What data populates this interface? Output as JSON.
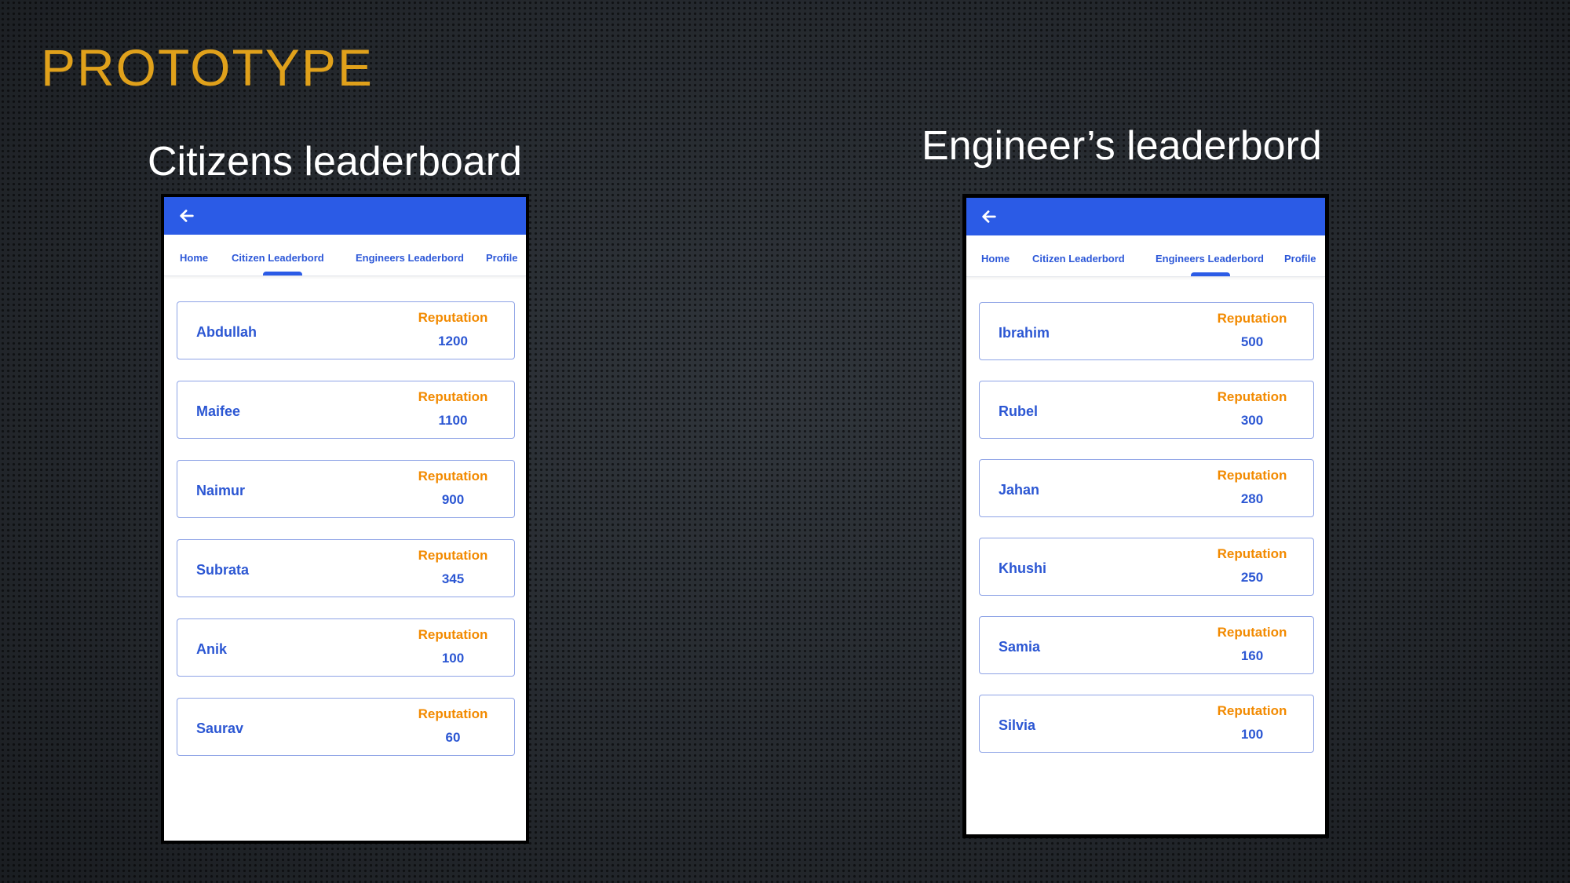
{
  "slide": {
    "title": "PROTOTYPE"
  },
  "colors": {
    "accent_title": "#e0a11b",
    "app_blue": "#2b5be6",
    "text_blue": "#2c57d3",
    "reputation_orange": "#f28a00"
  },
  "citizens": {
    "caption": "Citizens leaderboard",
    "back_icon": "arrow-left-icon",
    "tabs": [
      {
        "label": "Home",
        "active": false
      },
      {
        "label": "Citizen Leaderbord",
        "active": true
      },
      {
        "label": "Engineers Leaderbord",
        "active": false
      },
      {
        "label": "Profile",
        "active": false
      }
    ],
    "entries": [
      {
        "name": "Abdullah",
        "rep_label": "Reputation",
        "rep_value": "1200"
      },
      {
        "name": "Maifee",
        "rep_label": "Reputation",
        "rep_value": "1100"
      },
      {
        "name": "Naimur",
        "rep_label": "Reputation",
        "rep_value": "900"
      },
      {
        "name": "Subrata",
        "rep_label": "Reputation",
        "rep_value": "345"
      },
      {
        "name": "Anik",
        "rep_label": "Reputation",
        "rep_value": "100"
      },
      {
        "name": "Saurav",
        "rep_label": "Reputation",
        "rep_value": "60"
      }
    ]
  },
  "engineers": {
    "caption": "Engineer’s leaderbord",
    "back_icon": "arrow-left-icon",
    "tabs": [
      {
        "label": "Home",
        "active": false
      },
      {
        "label": "Citizen Leaderbord",
        "active": false
      },
      {
        "label": "Engineers Leaderbord",
        "active": true
      },
      {
        "label": "Profile",
        "active": false
      }
    ],
    "entries": [
      {
        "name": "Ibrahim",
        "rep_label": "Reputation",
        "rep_value": "500"
      },
      {
        "name": "Rubel",
        "rep_label": "Reputation",
        "rep_value": "300"
      },
      {
        "name": "Jahan",
        "rep_label": "Reputation",
        "rep_value": "280"
      },
      {
        "name": "Khushi",
        "rep_label": "Reputation",
        "rep_value": "250"
      },
      {
        "name": "Samia",
        "rep_label": "Reputation",
        "rep_value": "160"
      },
      {
        "name": "Silvia",
        "rep_label": "Reputation",
        "rep_value": "100"
      }
    ]
  }
}
